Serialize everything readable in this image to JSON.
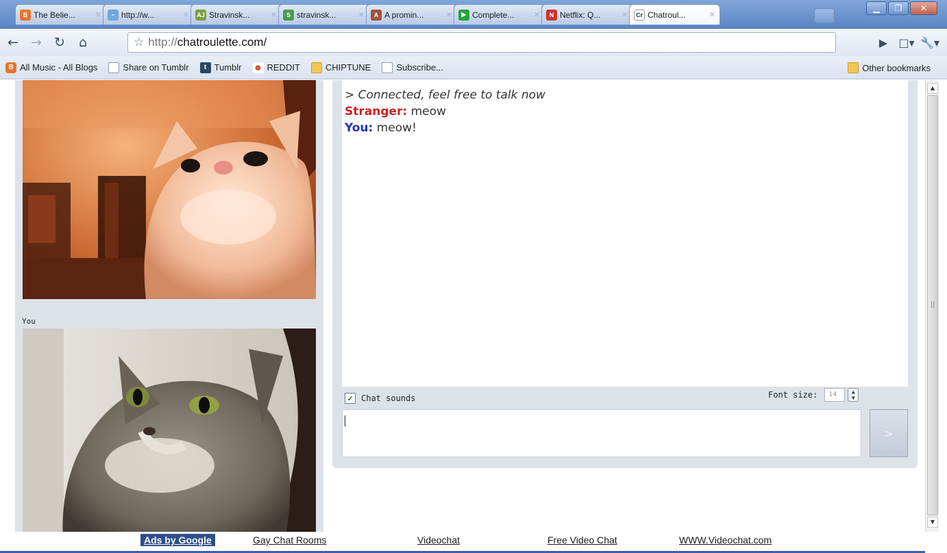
{
  "browser": {
    "tabs": [
      {
        "title": "The Belie...",
        "icon": "blogger-favicon",
        "color": "#e8742a",
        "glyph": "B"
      },
      {
        "title": "http://w...",
        "icon": "bird-favicon",
        "color": "#6fa8dc",
        "glyph": "~"
      },
      {
        "title": "Stravinsk...",
        "icon": "aj-favicon",
        "color": "#7aa23e",
        "glyph": "AJ"
      },
      {
        "title": "stravinsk...",
        "icon": "wiki-favicon",
        "color": "#4b9b4b",
        "glyph": "S"
      },
      {
        "title": "A promin...",
        "icon": "figure-favicon",
        "color": "#a0523b",
        "glyph": "A"
      },
      {
        "title": "Complete...",
        "icon": "play-favicon",
        "color": "#22a33a",
        "glyph": "▶"
      },
      {
        "title": "Netflix: Q...",
        "icon": "netflix-favicon",
        "color": "#c7352b",
        "glyph": "N"
      },
      {
        "title": "Chatroul...",
        "icon": "chatroulette-favicon",
        "color": "#ffffff",
        "glyph": "Cr",
        "active": true
      }
    ],
    "window_buttons": {
      "minimize": "▁",
      "maximize": "❐",
      "close": "✕"
    },
    "address": {
      "protocol": "http://",
      "host": "chatroulette.com/"
    },
    "bookmarks": [
      {
        "label": "All Music - All Blogs",
        "icon": "blogger-icon",
        "kind": "blogger",
        "glyph": "B"
      },
      {
        "label": "Share on Tumblr",
        "icon": "page-icon",
        "kind": "page",
        "glyph": ""
      },
      {
        "label": "Tumblr",
        "icon": "tumblr-icon",
        "kind": "tumblr",
        "glyph": "t"
      },
      {
        "label": "REDDIT",
        "icon": "reddit-icon",
        "kind": "reddit",
        "glyph": "☻"
      },
      {
        "label": "CHIPTUNE",
        "icon": "folder-icon",
        "kind": "folder",
        "glyph": ""
      },
      {
        "label": "Subscribe...",
        "icon": "page-icon",
        "kind": "page",
        "glyph": ""
      }
    ],
    "other_bookmarks": "Other bookmarks"
  },
  "chat": {
    "you_label": "You",
    "messages": [
      {
        "kind": "system",
        "text": "> Connected, feel free to talk now"
      },
      {
        "kind": "stranger",
        "who": "Stranger:",
        "text": " meow"
      },
      {
        "kind": "you",
        "who": "You:",
        "text": " meow!"
      }
    ],
    "chat_sounds_label": "Chat sounds",
    "chat_sounds_checked": true,
    "font_size_label": "Font size:",
    "font_size_value": "14",
    "input_value": "",
    "send_label": ">"
  },
  "footer": {
    "ads_label": "Ads by Google",
    "links": [
      "Gay Chat Rooms",
      "Videochat",
      "Free Video Chat",
      "WWW.Videochat.com"
    ]
  },
  "colors": {
    "stranger_name": "#cc2222",
    "you_name": "#2233bb",
    "panel_bg": "#dde2e8",
    "footer_rule": "#3a62a8"
  }
}
